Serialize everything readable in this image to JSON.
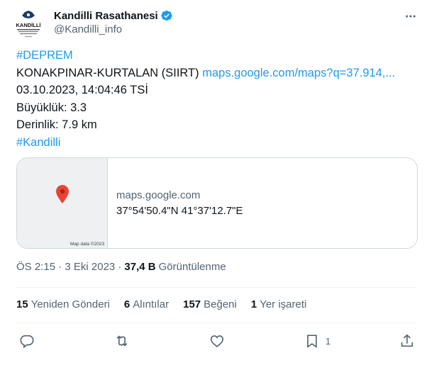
{
  "author": {
    "display_name": "Kandilli Rasathanesi",
    "handle": "@Kandilli_info",
    "avatar_text": "KANDİLLİ"
  },
  "tweet": {
    "hashtag_top": "#DEPREM",
    "location": "KONAKPINAR-KURTALAN (SIIRT)",
    "map_link": "maps.google.com/maps?q=37.914,...",
    "date_line": "03.10.2023, 14:04:46 TSİ",
    "magnitude": "Büyüklük: 3.3",
    "depth": "Derinlik: 7.9 km",
    "hashtag_bottom": "#Kandilli"
  },
  "card": {
    "domain": "maps.google.com",
    "coords": "37°54'50.4\"N 41°37'12.7\"E",
    "map_credit": "Map data ©2023"
  },
  "meta": {
    "timestamp": "ÖS 2:15 · 3 Eki 2023 ·",
    "views_count": "37,4 B",
    "views_label": "Görüntülenme"
  },
  "stats": {
    "retweets_count": "15",
    "retweets_label": "Yeniden Gönderi",
    "quotes_count": "6",
    "quotes_label": "Alıntılar",
    "likes_count": "157",
    "likes_label": "Beğeni",
    "bookmarks_count": "1",
    "bookmarks_label": "Yer işareti"
  },
  "actions": {
    "bookmark_count": "1"
  },
  "colors": {
    "link": "#1d9bf0",
    "verified": "#1d9bf0",
    "secondary_text": "#536471",
    "pin": "#ea4335"
  },
  "icons": [
    "verified-badge-icon",
    "more-icon",
    "map-pin-icon",
    "reply-icon",
    "retweet-icon",
    "like-icon",
    "bookmark-icon",
    "share-icon"
  ]
}
